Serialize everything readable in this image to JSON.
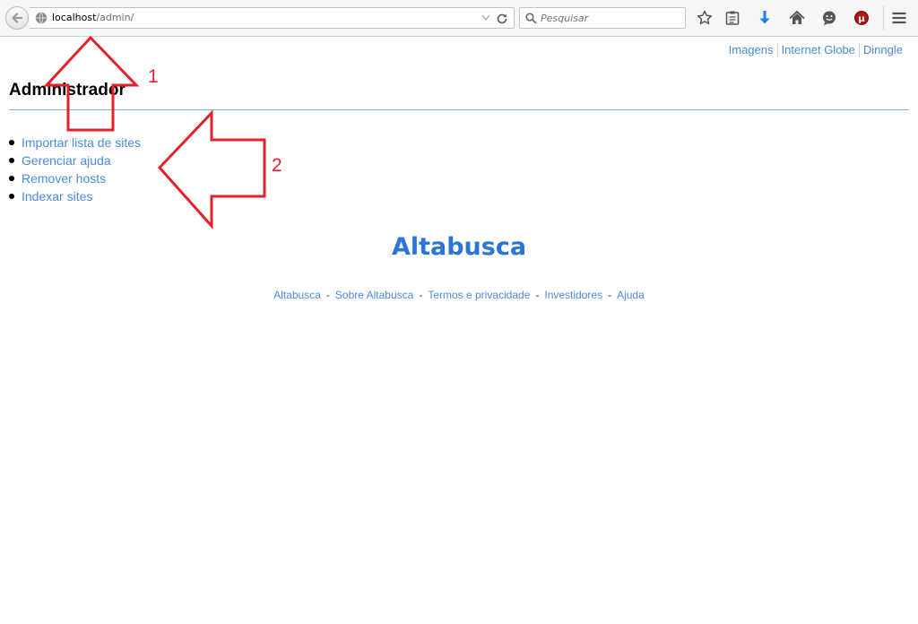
{
  "browser": {
    "url_host": "localhost",
    "url_path": "/admin/",
    "search_placeholder": "Pesquisar"
  },
  "top_nav": {
    "links": [
      "Imagens",
      "Internet Globe",
      "Dinngle"
    ]
  },
  "page": {
    "title": "Administrador",
    "menu": [
      "Importar lista de sites",
      "Gerenciar ajuda",
      "Remover hosts",
      "Indexar sites"
    ]
  },
  "brand": "Altabusca",
  "footer": {
    "links": [
      "Altabusca",
      "Sobre Altabusca",
      "Termos e privacidade",
      "Investidores",
      "Ajuda"
    ],
    "separator": "-"
  },
  "annotations": {
    "label_1": "1",
    "label_2": "2",
    "color": "#e2212b"
  },
  "colors": {
    "link": "#4a8ae0",
    "brand": "#2b74db",
    "rule": "#7bb0d8"
  }
}
